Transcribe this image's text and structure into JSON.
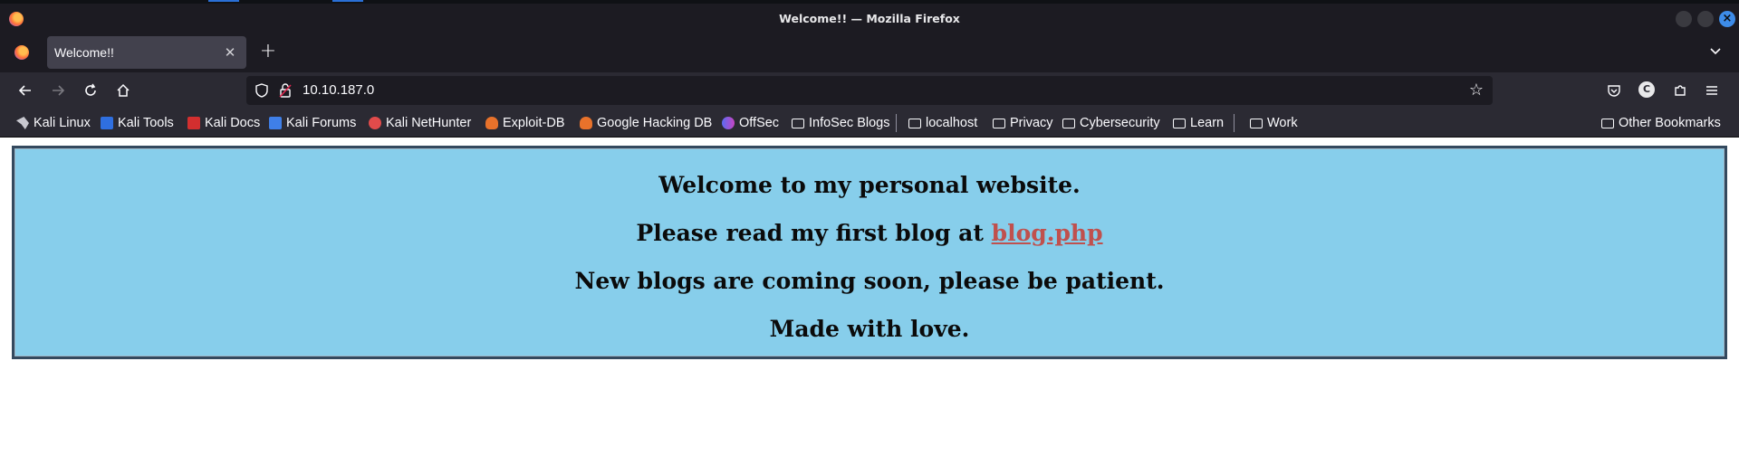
{
  "window": {
    "title": "Welcome!! — Mozilla Firefox"
  },
  "tabs": [
    {
      "title": "Welcome!!",
      "active": true
    }
  ],
  "navbar": {
    "url": "10.10.187.0"
  },
  "bookmarks": {
    "items": [
      {
        "label": "Kali Linux",
        "icon": "kali-icon"
      },
      {
        "label": "Kali Tools",
        "icon": "kali-tools-icon"
      },
      {
        "label": "Kali Docs",
        "icon": "kali-docs-icon"
      },
      {
        "label": "Kali Forums",
        "icon": "kali-forums-icon"
      },
      {
        "label": "Kali NetHunter",
        "icon": "nethunter-icon"
      },
      {
        "label": "Exploit-DB",
        "icon": "exploit-db-icon"
      },
      {
        "label": "Google Hacking DB",
        "icon": "exploit-db-icon"
      },
      {
        "label": "OffSec",
        "icon": "offsec-icon"
      },
      {
        "label": "InfoSec Blogs",
        "icon": "folder-icon"
      },
      {
        "label": "localhost",
        "icon": "folder-icon"
      },
      {
        "label": "Privacy",
        "icon": "folder-icon"
      },
      {
        "label": "Cybersecurity",
        "icon": "folder-icon"
      },
      {
        "label": "Learn",
        "icon": "folder-icon"
      },
      {
        "label": "Work",
        "icon": "folder-icon"
      }
    ],
    "other": "Other Bookmarks"
  },
  "page": {
    "line1": "Welcome to my personal website.",
    "line2_prefix": "Please read my first blog at",
    "line2_link": "blog.php",
    "line3": "New blogs are coming soon, please be patient.",
    "line4": "Made with love."
  },
  "profile": {
    "initial": "C"
  },
  "colors": {
    "panel_bg": "#87ceeb",
    "panel_border": "#34495e",
    "link": "#c0504d",
    "chrome_dark": "#1c1b22",
    "chrome_toolbar": "#2b2a33"
  }
}
